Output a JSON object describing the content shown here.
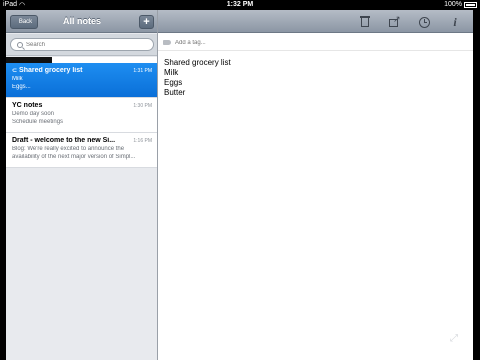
{
  "status_bar": {
    "carrier": "iPad",
    "time": "1:32 PM",
    "battery": "100%"
  },
  "sidebar": {
    "back_label": "Back",
    "title": "All notes",
    "add_label": "+",
    "search_placeholder": "Search"
  },
  "notes": [
    {
      "title": "Shared grocery list",
      "time": "1:31 PM",
      "lines": [
        "Milk",
        "Eggs..."
      ],
      "shared": true,
      "selected": true
    },
    {
      "title": "YC notes",
      "time": "1:30 PM",
      "lines": [
        "Demo day soon",
        "Schedule meetings"
      ],
      "shared": false,
      "selected": false
    },
    {
      "title": "Draft - welcome to the new Si...",
      "time": "1:16 PM",
      "lines": [
        "Blog: We're really excited to announce the",
        "availability of the next major version of Simpl..."
      ],
      "shared": false,
      "selected": false
    }
  ],
  "editor": {
    "tag_placeholder": "Add a tag...",
    "body_lines": [
      "Shared grocery list",
      "Milk",
      "Eggs",
      "Butter"
    ],
    "toolbar_icons": [
      "trash-icon",
      "export-icon",
      "clock-icon",
      "info-icon"
    ]
  },
  "colors": {
    "selected_row": "#0a6fd8",
    "toolbar": "#8b96a4"
  }
}
